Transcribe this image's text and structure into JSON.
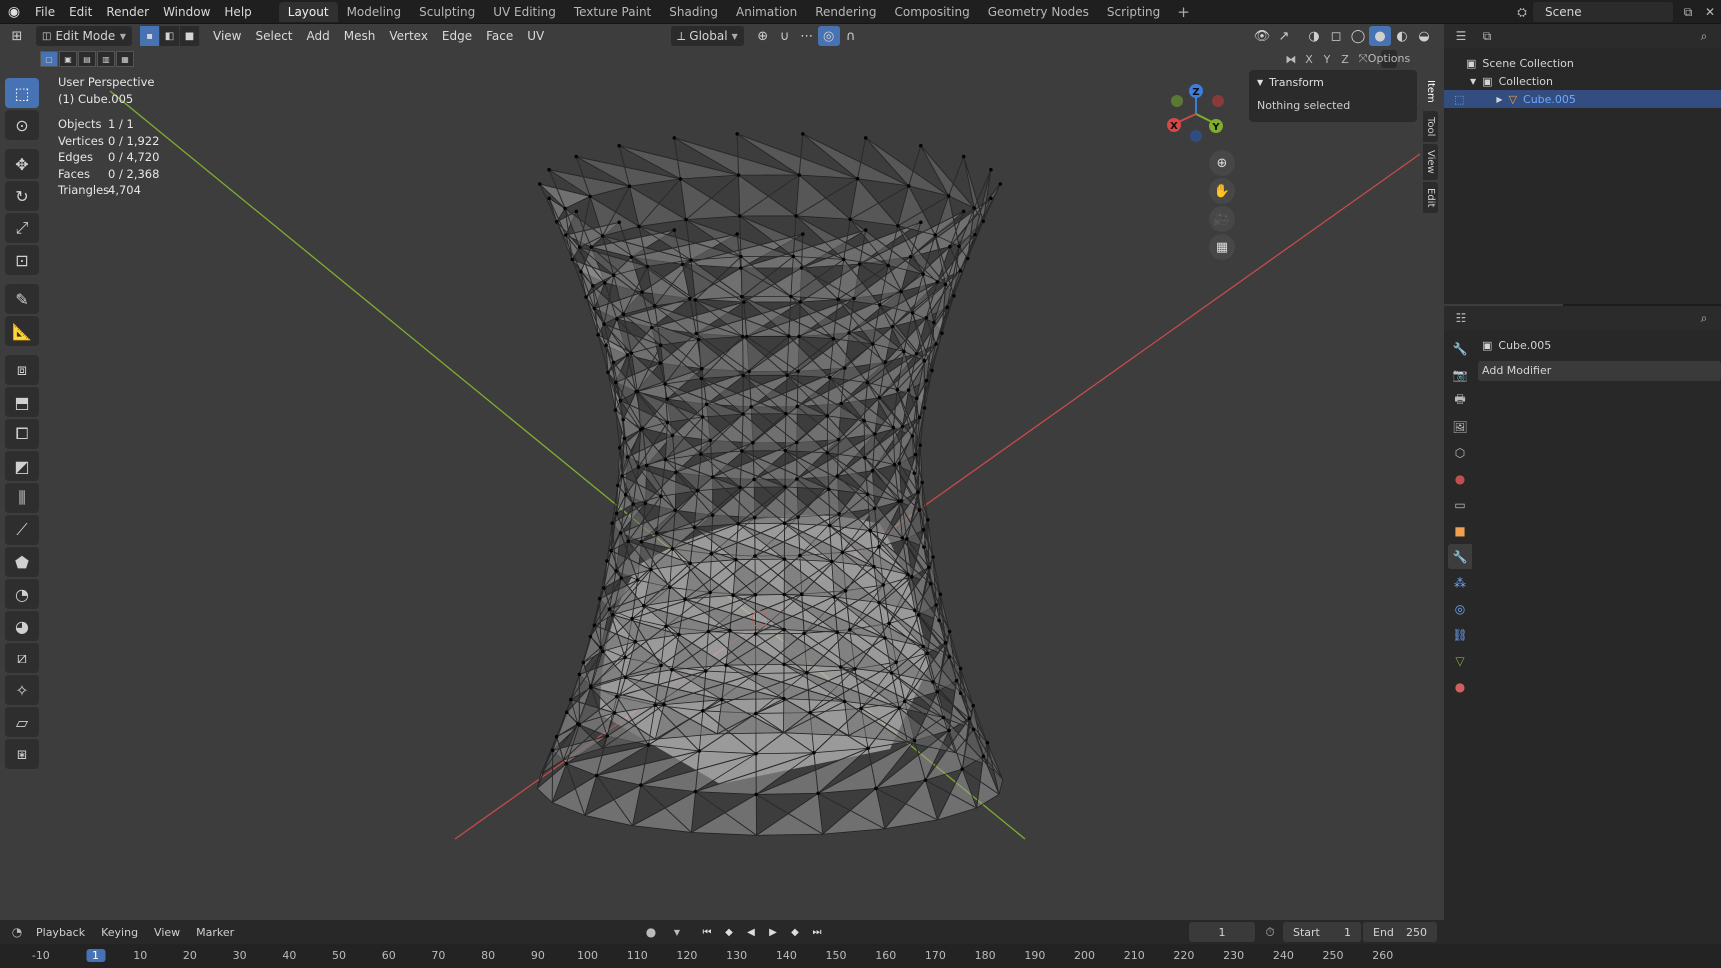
{
  "topbar": {
    "menus": [
      "File",
      "Edit",
      "Render",
      "Window",
      "Help"
    ],
    "workspaces": [
      "Layout",
      "Modeling",
      "Sculpting",
      "UV Editing",
      "Texture Paint",
      "Shading",
      "Animation",
      "Rendering",
      "Compositing",
      "Geometry Nodes",
      "Scripting"
    ],
    "active_workspace": "Layout",
    "scene": "Scene"
  },
  "viewport_header": {
    "mode": "Edit Mode",
    "menus": [
      "View",
      "Select",
      "Add",
      "Mesh",
      "Vertex",
      "Edge",
      "Face",
      "UV"
    ],
    "orientation": "Global",
    "axis_x": "X",
    "axis_y": "Y",
    "axis_z": "Z",
    "options": "Options"
  },
  "overlay": {
    "title": "User Perspective",
    "object": "(1) Cube.005",
    "stats": [
      {
        "k": "Objects",
        "v": "1 / 1"
      },
      {
        "k": "Vertices",
        "v": "0 / 1,922"
      },
      {
        "k": "Edges",
        "v": "0 / 4,720"
      },
      {
        "k": "Faces",
        "v": "0 / 2,368"
      },
      {
        "k": "Triangles",
        "v": "4,704"
      }
    ]
  },
  "gizmo": {
    "x": "X",
    "y": "Y",
    "z": "Z"
  },
  "npanel": {
    "section": "Transform",
    "message": "Nothing selected",
    "tabs": [
      "Item",
      "Tool",
      "View",
      "Edit"
    ]
  },
  "outliner": {
    "root": "Scene Collection",
    "collection": "Collection",
    "object": "Cube.005"
  },
  "properties": {
    "object_name": "Cube.005",
    "add_modifier": "Add Modifier"
  },
  "timeline": {
    "menus": [
      "Playback",
      "Keying",
      "View",
      "Marker"
    ],
    "current_frame": "1",
    "start_label": "Start",
    "start": "1",
    "end_label": "End",
    "end": "250",
    "ruler": [
      "-10",
      "1",
      "10",
      "20",
      "30",
      "40",
      "50",
      "60",
      "70",
      "80",
      "90",
      "100",
      "110",
      "120",
      "130",
      "140",
      "150",
      "160",
      "170",
      "180",
      "190",
      "200",
      "210",
      "220",
      "230",
      "240",
      "250",
      "260"
    ]
  },
  "colors": {
    "accent": "#4772b3",
    "x_axis": "#c84a4a",
    "y_axis": "#7fae2e",
    "z_axis": "#3b7de0",
    "mesh": "#a8a8a8"
  }
}
